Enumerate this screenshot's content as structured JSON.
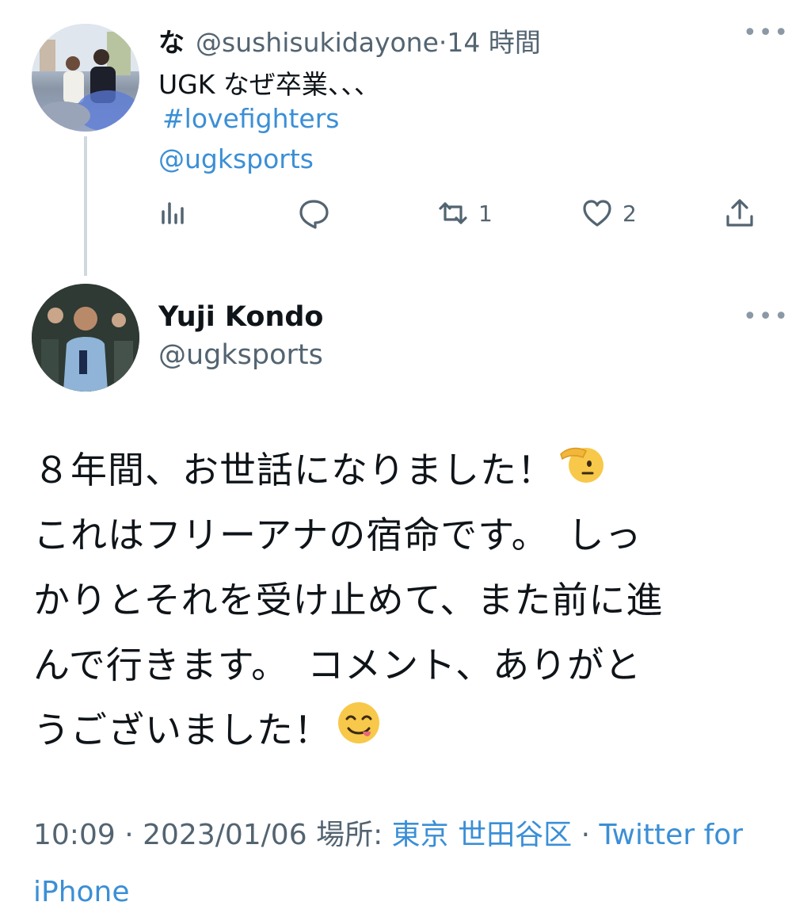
{
  "reply_tweet": {
    "display_name": "な",
    "handle": "@sushisukidayone",
    "time": "14 時間",
    "separator": "·",
    "text_line1": "UGK なぜ卒業、、、",
    "hashtag": "#lovefighters",
    "mention": "@ugksports",
    "actions": {
      "analytics_icon": "bar-chart-icon",
      "reply_icon": "speech-bubble-icon",
      "retweet_icon": "retweet-icon",
      "retweet_count": "1",
      "like_icon": "heart-icon",
      "like_count": "2",
      "share_icon": "share-icon"
    },
    "more_icon": "ellipsis-icon"
  },
  "main_tweet": {
    "display_name": "Yuji Kondo",
    "handle": "@ugksports",
    "more_icon": "ellipsis-icon",
    "lines": [
      "８年間、お世話になりました！",
      "これはフリーアナの宿命です。　しっ",
      "かりとそれを受け止めて、また前に進",
      "んで行きます。　コメント、ありがと",
      "うございました！"
    ],
    "emoji_1": "saluting-face-emoji",
    "emoji_2": "face-savoring-food-emoji",
    "footer": {
      "time": "10:09",
      "sep": "·",
      "date": "2023/01/06",
      "place_label": "場所:",
      "place": "東京 世田谷区",
      "sep2": "·",
      "client_a": "Twitter for",
      "client_b": "iPhone"
    }
  },
  "colors": {
    "text": "#0f1419",
    "secondary": "#536471",
    "link": "#3b8fd6",
    "thread_line": "#cfd9de"
  }
}
